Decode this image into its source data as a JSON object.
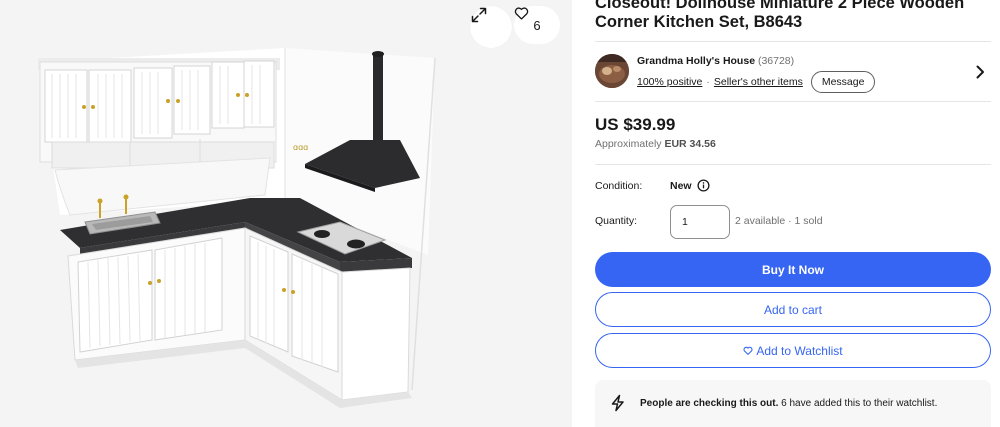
{
  "listing": {
    "title": "Closeout! Dollhouse Miniature 2 Piece Wooden Corner Kitchen Set, B8643",
    "gallery": {
      "watch_count": "6",
      "expand_icon": "expand-arrows-icon",
      "heart_icon": "heart-outline-icon"
    },
    "seller": {
      "name": "Grandma Holly's House",
      "feedback_count": "(36728)",
      "positive": "100% positive",
      "separator": "·",
      "other_items": "Seller's other items",
      "message_label": "Message"
    },
    "price": {
      "amount": "US $39.99",
      "approx_prefix": "Approximately",
      "approx_value": "EUR 34.56"
    },
    "condition": {
      "label": "Condition:",
      "value": "New"
    },
    "quantity": {
      "label": "Quantity:",
      "value": "1",
      "availability": "2 available · 1 sold"
    },
    "actions": {
      "buy_now": "Buy It Now",
      "add_to_cart": "Add to cart",
      "watchlist": "Add to Watchlist"
    },
    "notice": {
      "headline": "People are checking this out.",
      "detail": "6 have added this to their watchlist."
    }
  },
  "colors": {
    "accent": "#3665f3",
    "text": "#191919",
    "muted": "#707070"
  }
}
